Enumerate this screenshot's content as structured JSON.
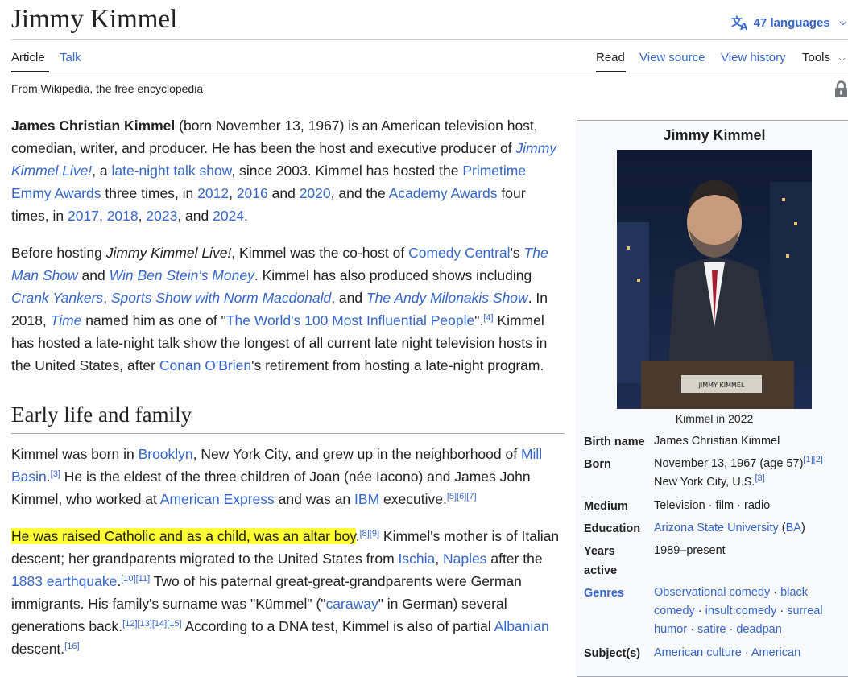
{
  "page": {
    "title": "Jimmy Kimmel",
    "languages_label": "47 languages",
    "tabs": [
      "Article",
      "Talk"
    ],
    "views": [
      "Read",
      "View source",
      "View history",
      "Tools"
    ],
    "tagline": "From Wikipedia, the free encyclopedia"
  },
  "section": {
    "heading": "Early life and family"
  },
  "infobox": {
    "title": "Jimmy Kimmel",
    "caption": "Kimmel in 2022",
    "nameplate": "JIMMY KIMMEL",
    "rows": {
      "birth_name": {
        "label": "Birth name",
        "value": "James Christian Kimmel"
      },
      "born": {
        "label": "Born",
        "value_line1": "November 13, 1967 (age 57)",
        "refs_line1": "[1][2]",
        "value_line2": "New York City, U.S.",
        "refs_line2": "[3]"
      },
      "medium": {
        "label": "Medium",
        "value": "Television · film · radio"
      },
      "education": {
        "label": "Education",
        "link": "Arizona State University",
        "paren_link": "BA"
      },
      "years_active": {
        "label_1": "Years",
        "label_2": "active",
        "value": "1989–present"
      },
      "genres": {
        "label": "Genres",
        "items": [
          "Observational comedy",
          "black comedy",
          "insult comedy",
          "surreal humor",
          "satire",
          "deadpan"
        ]
      },
      "subjects": {
        "label": "Subject(s)",
        "items": [
          "American culture",
          "American"
        ]
      }
    }
  },
  "colors": {
    "link": "#3366cc",
    "highlight": "#ffff33",
    "text": "#202122",
    "infobox_bg": "#f8f9fa"
  }
}
